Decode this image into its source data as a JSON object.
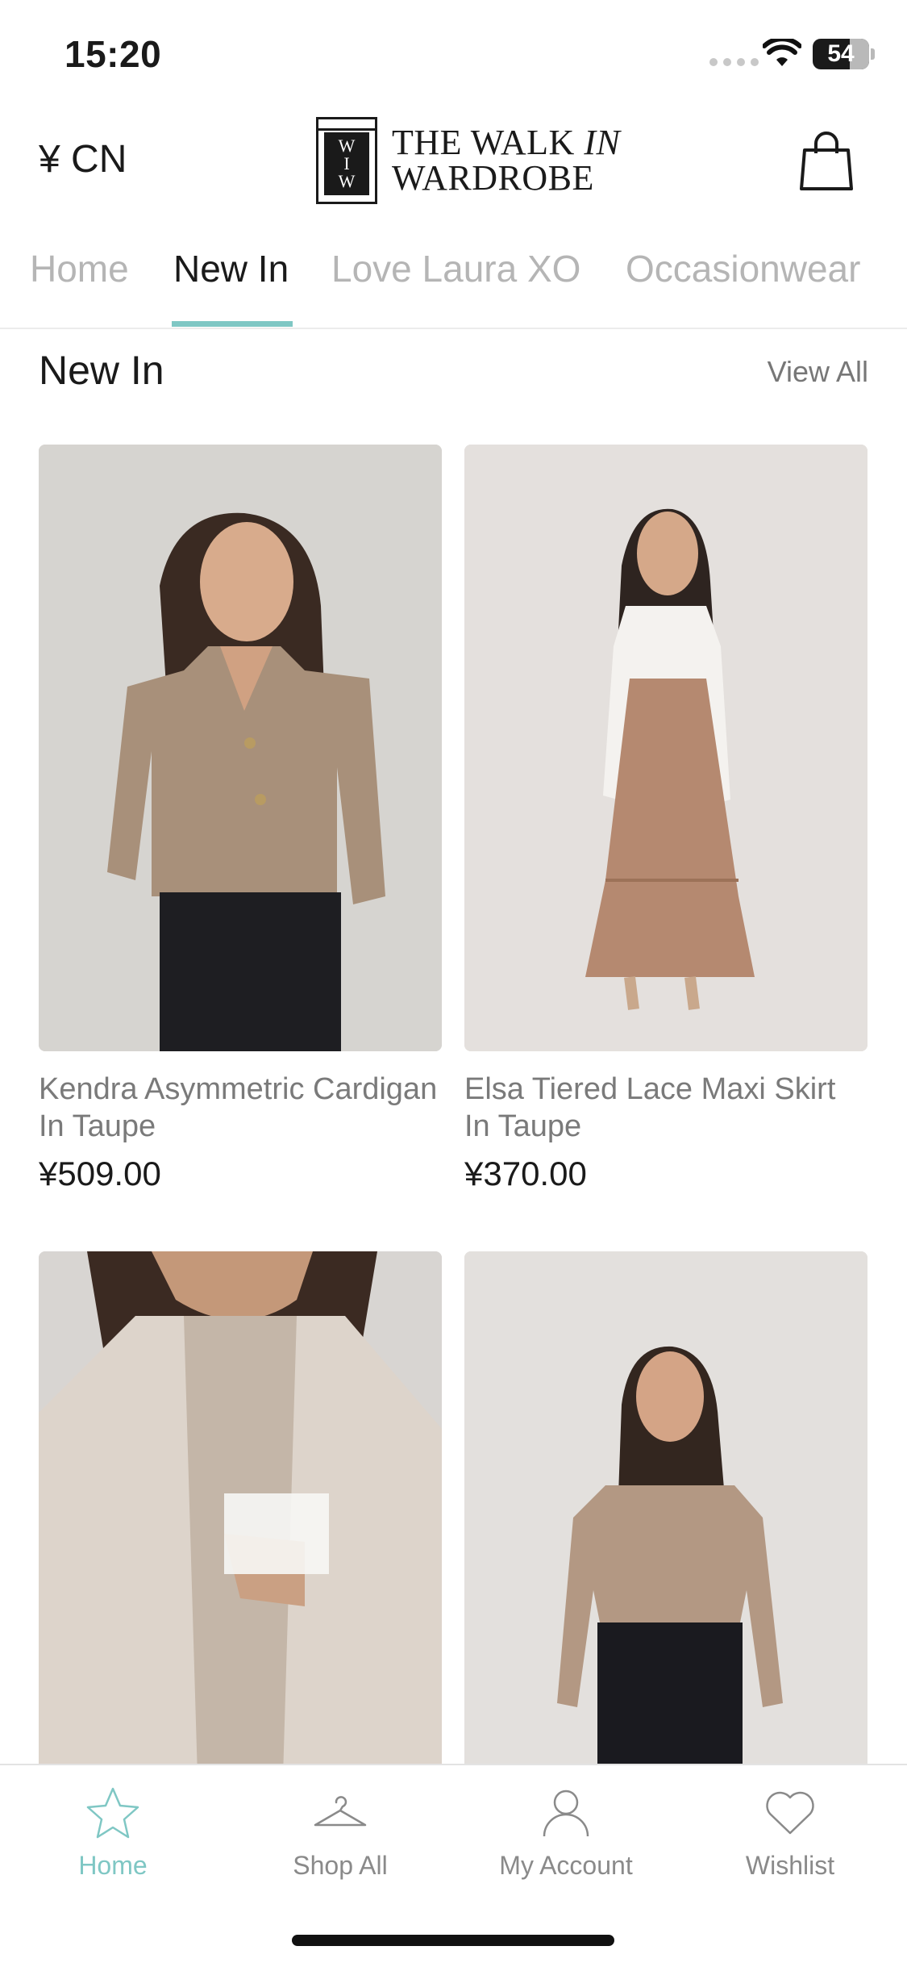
{
  "status_bar": {
    "time": "15:20",
    "battery": "54"
  },
  "header": {
    "currency": "¥ CN",
    "logo": {
      "mark": "WI\nW",
      "line1_a": "THE WALK ",
      "line1_b": "IN",
      "line2": "WARDROBE"
    }
  },
  "tabs": [
    {
      "label": "Home",
      "active": false
    },
    {
      "label": "New In",
      "active": true
    },
    {
      "label": "Love Laura XO",
      "active": false
    },
    {
      "label": "Occasionwear",
      "active": false
    }
  ],
  "section": {
    "title": "New In",
    "view_all": "View All"
  },
  "products": [
    {
      "name": "Kendra Asymmetric Cardigan In Taupe",
      "price": "¥509.00"
    },
    {
      "name": "Elsa Tiered Lace Maxi Skirt In Taupe",
      "price": "¥370.00"
    },
    {
      "name": "",
      "price": ""
    },
    {
      "name": "",
      "price": ""
    }
  ],
  "bottom_nav": [
    {
      "label": "Home",
      "icon": "star-icon",
      "active": true
    },
    {
      "label": "Shop All",
      "icon": "hanger-icon",
      "active": false
    },
    {
      "label": "My Account",
      "icon": "user-icon",
      "active": false
    },
    {
      "label": "Wishlist",
      "icon": "heart-icon",
      "active": false
    }
  ],
  "colors": {
    "accent": "#7fc7c4",
    "text": "#1a1a1a",
    "muted": "#b5b5b5"
  }
}
